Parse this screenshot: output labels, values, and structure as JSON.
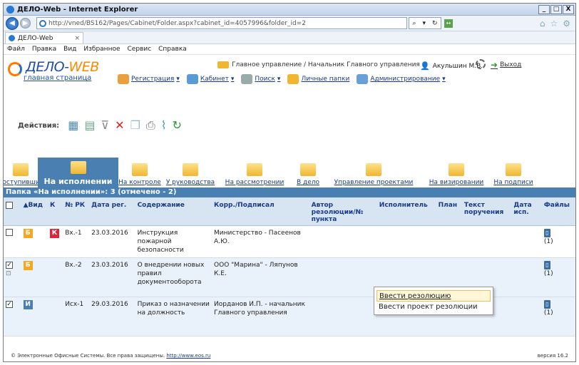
{
  "window": {
    "title": "ДЕЛО-Web - Internet Explorer",
    "buttons": [
      "_",
      "□",
      "X"
    ]
  },
  "address": {
    "url": "http://vned/BS162/Pages/Cabinet/Folder.aspx?cabinet_id=4057996&folder_id=2"
  },
  "browser_tab": {
    "label": "ДЕЛО-Web"
  },
  "menu": [
    "Файл",
    "Правка",
    "Вид",
    "Избранное",
    "Сервис",
    "Справка"
  ],
  "logo": {
    "name": "ДЕЛО-",
    "name2": "WEB",
    "subtitle": "главная страница"
  },
  "breadcrumb": "Главное управление / Начальник Главного управления",
  "user": "Акульшин М.В.",
  "exit": "Выход",
  "topnav": [
    {
      "label": "Регистрация",
      "icon": "registration-icon",
      "color": "#e8a040"
    },
    {
      "label": "Кабинет",
      "icon": "cabinet-icon",
      "color": "#5b9bd5"
    },
    {
      "label": "Поиск",
      "icon": "search-icon",
      "color": "#9aa"
    },
    {
      "label": "Личные папки",
      "icon": "personal-folders-icon",
      "color": "#f0b630"
    },
    {
      "label": "Администрирование",
      "icon": "admin-icon",
      "color": "#6aa0d8"
    }
  ],
  "actions": {
    "label": "Действия:"
  },
  "folders": [
    "Поступившие",
    "На исполнении",
    "На контроле",
    "У руководства",
    "На рассмотрении",
    "В дело",
    "Управление проектами",
    "На визировании",
    "На подписи"
  ],
  "folder_header": "Папка «На исполнении»: 3 (отмечено - 2)",
  "columns": [
    "▲Вид",
    "К",
    "№ РК",
    "Дата рег.",
    "Содержание",
    "Корр./Подписал",
    "Автор резолюции/№ пункта",
    "Исполнитель",
    "План",
    "Текст поручения",
    "Дата исп.",
    "Файлы"
  ],
  "rows": [
    {
      "checked": "",
      "kind": "Б",
      "kind_color": "#f5a623",
      "k": "К",
      "num": "Вх.-1",
      "date": "23.03.2016",
      "content": "Инструкция пожарной безопасности",
      "corr": "Министерство - Пасеенов А.Ю.",
      "files": "(1)"
    },
    {
      "checked": "✓",
      "kind": "Б",
      "kind_color": "#f5a623",
      "k": "",
      "num": "Вх.-2",
      "date": "23.03.2016",
      "content": "О внедрении новых правил документооборота",
      "corr": "ООО \"Марина\" - Ляпунов К.Е.",
      "files": "(1)"
    },
    {
      "checked": "✓",
      "kind": "И",
      "kind_color": "#4a7fb2",
      "k": "",
      "num": "Исх-1",
      "date": "29.03.2016",
      "content": "Приказ о назначении на должность",
      "corr": "Иорданов И.П. - начальник Главного управления",
      "files": "(1)"
    }
  ],
  "context_menu": [
    "Ввести резолюцию",
    "Ввести проект резолюции"
  ],
  "footer": {
    "text": "© Электронные Офисные Системы. Все права защищены.",
    "link": "http://www.eos.ru",
    "version": "версия 16.2"
  }
}
